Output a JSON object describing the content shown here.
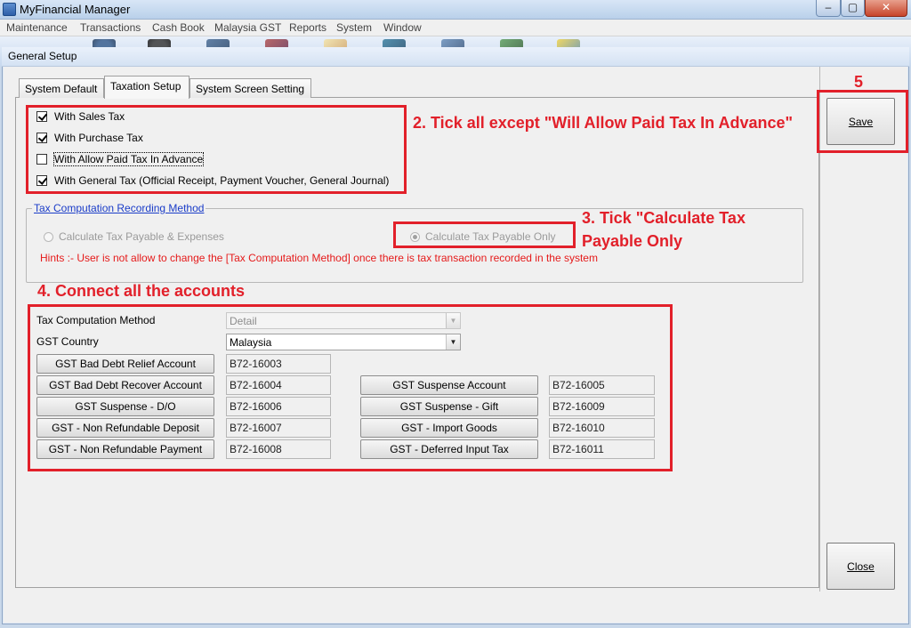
{
  "app": {
    "title": "MyFinancial Manager",
    "icon": "app-icon"
  },
  "window_controls": {
    "minimize": "–",
    "maximize": "▢",
    "close": "✕"
  },
  "menu": [
    "Maintenance",
    "Transactions",
    "Cash Book",
    "Malaysia GST",
    "Reports",
    "System",
    "Window"
  ],
  "toolbar": {
    "icons": [
      "user-icon",
      "user-icon",
      "book-icon",
      "book-icon",
      "document-icon",
      "ledger-icon",
      "binder-icon",
      "calendar-icon",
      "chart-icon"
    ]
  },
  "dialog": {
    "title": "General Setup"
  },
  "tabs": [
    {
      "label": "System Default"
    },
    {
      "label": "Taxation Setup",
      "active": true
    },
    {
      "label": "System Screen Setting"
    }
  ],
  "tax_options": [
    {
      "label": "With Sales Tax",
      "checked": true
    },
    {
      "label": "With Purchase Tax",
      "checked": true
    },
    {
      "label": "With Allow Paid Tax In Advance",
      "checked": false
    },
    {
      "label": "With General Tax (Official Receipt, Payment Voucher, General Journal)",
      "checked": true
    }
  ],
  "computation": {
    "group_title": "Tax Computation Recording Method",
    "options": [
      {
        "label": "Calculate Tax Payable & Expenses",
        "selected": false
      },
      {
        "label": "Calculate Tax Payable Only",
        "selected": true
      }
    ],
    "hint": "Hints :- User is not allow to change the [Tax Computation Method] once there is tax transaction recorded in the system"
  },
  "settings": {
    "method_label": "Tax Computation Method",
    "method_value": "Detail",
    "country_label": "GST Country",
    "country_value": "Malaysia"
  },
  "accounts_left": [
    {
      "label": "GST Bad Debt Relief Account",
      "value": "B72-16003"
    },
    {
      "label": "GST Bad Debt Recover Account",
      "value": "B72-16004"
    },
    {
      "label": "GST Suspense - D/O",
      "value": "B72-16006"
    },
    {
      "label": "GST - Non Refundable Deposit",
      "value": "B72-16007"
    },
    {
      "label": "GST - Non Refundable Payment",
      "value": "B72-16008"
    }
  ],
  "accounts_right": [
    {
      "label": "GST Suspense Account",
      "value": "B72-16005"
    },
    {
      "label": "GST Suspense - Gift",
      "value": "B72-16009"
    },
    {
      "label": "GST - Import Goods",
      "value": "B72-16010"
    },
    {
      "label": "GST - Deferred Input Tax",
      "value": "B72-16011"
    }
  ],
  "buttons": {
    "save": "Save",
    "close": "Close"
  },
  "annotations": {
    "step2": "2. Tick all except \"Will Allow Paid Tax In Advance\"",
    "step3_line1": "3. Tick \"Calculate Tax",
    "step3_line2": "Payable Only",
    "step4": "4. Connect all the accounts",
    "step5": "5",
    "color": "#e2202a"
  }
}
